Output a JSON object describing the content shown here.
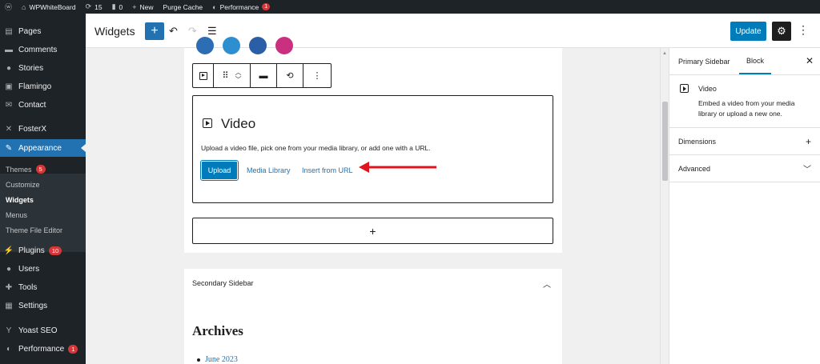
{
  "admin_bar": {
    "site_name": "WPWhiteBoard",
    "updates_count": "15",
    "comments_count": "0",
    "new_label": "New",
    "purge_cache_label": "Purge Cache",
    "performance_label": "Performance",
    "performance_badge": "1"
  },
  "sidebar": {
    "items": [
      {
        "label": "Pages",
        "icon": "pages-icon"
      },
      {
        "label": "Comments",
        "icon": "comments-icon"
      },
      {
        "label": "Stories",
        "icon": "stories-icon"
      },
      {
        "label": "Flamingo",
        "icon": "flamingo-icon"
      },
      {
        "label": "Contact",
        "icon": "contact-icon"
      },
      {
        "label": "FosterX",
        "icon": "fosterx-icon"
      },
      {
        "label": "Appearance",
        "icon": "appearance-icon"
      },
      {
        "label": "Plugins",
        "icon": "plugins-icon",
        "badge": "10"
      },
      {
        "label": "Users",
        "icon": "users-icon"
      },
      {
        "label": "Tools",
        "icon": "tools-icon"
      },
      {
        "label": "Settings",
        "icon": "settings-icon"
      },
      {
        "label": "Yoast SEO",
        "icon": "yoast-icon"
      },
      {
        "label": "Performance",
        "icon": "performance-icon",
        "badge": "1"
      }
    ],
    "submenu": [
      {
        "label": "Themes",
        "badge": "5"
      },
      {
        "label": "Customize"
      },
      {
        "label": "Widgets"
      },
      {
        "label": "Menus"
      },
      {
        "label": "Theme File Editor"
      }
    ]
  },
  "header": {
    "title": "Widgets",
    "update_label": "Update"
  },
  "video_block": {
    "title": "Video",
    "instructions": "Upload a video file, pick one from your media library, or add one with a URL.",
    "upload_label": "Upload",
    "media_library_label": "Media Library",
    "insert_url_label": "Insert from URL"
  },
  "appender": {
    "label": "+"
  },
  "secondary_panel": {
    "title": "Secondary Sidebar",
    "heading": "Archives",
    "item": "June 2023"
  },
  "settings_panel": {
    "tab_sidebar": "Primary Sidebar",
    "tab_block": "Block",
    "block_name": "Video",
    "block_description": "Embed a video from your media library or upload a new one.",
    "dimensions_label": "Dimensions",
    "advanced_label": "Advanced"
  },
  "colors": {
    "admin_dark": "#1d2327",
    "accent": "#2271b1",
    "primary_button": "#007cba",
    "badge": "#d63638",
    "annotation_arrow": "#e0141e"
  }
}
